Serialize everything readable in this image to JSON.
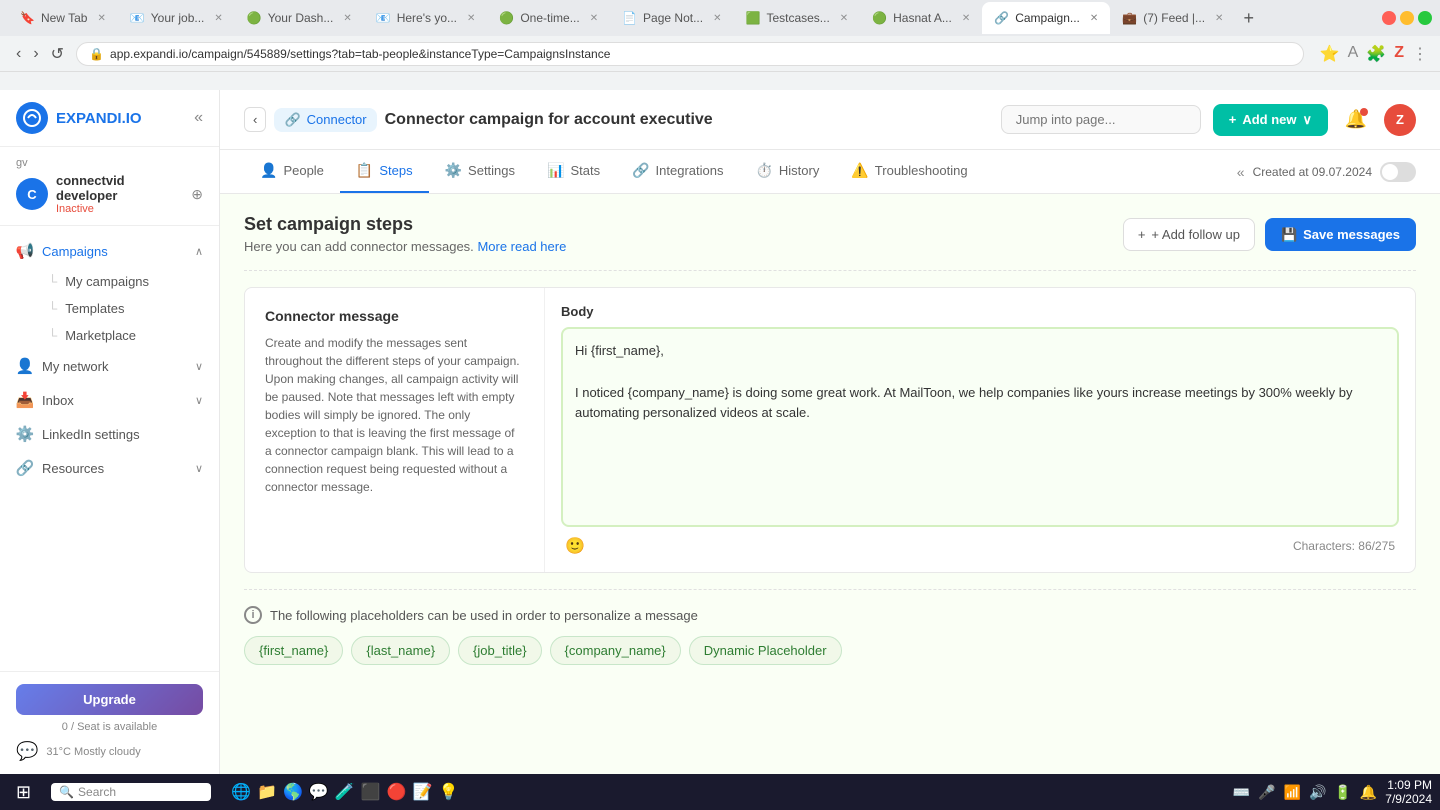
{
  "browser": {
    "tabs": [
      {
        "id": "new-tab",
        "label": "New Tab",
        "active": false,
        "favicon": "🔖"
      },
      {
        "id": "your-job",
        "label": "Your job...",
        "active": false,
        "favicon": "📧"
      },
      {
        "id": "your-dash",
        "label": "Your Dash...",
        "active": false,
        "favicon": "🟢"
      },
      {
        "id": "heres-yo",
        "label": "Here's yo...",
        "active": false,
        "favicon": "📧"
      },
      {
        "id": "one-time",
        "label": "One-time...",
        "active": false,
        "favicon": "🟢"
      },
      {
        "id": "page-not",
        "label": "Page Not...",
        "active": false,
        "favicon": "📄"
      },
      {
        "id": "testcases",
        "label": "Testcases...",
        "active": false,
        "favicon": "🟩"
      },
      {
        "id": "hasnat-a",
        "label": "Hasnat A...",
        "active": false,
        "favicon": "🟢"
      },
      {
        "id": "campaign",
        "label": "Campaign...",
        "active": true,
        "favicon": "🔗"
      },
      {
        "id": "linkedin-feed",
        "label": "(7) Feed |...",
        "active": false,
        "favicon": "💼"
      }
    ],
    "url": "app.expandi.io/campaign/545889/settings?tab=tab-people&instanceType=CampaignsInstance"
  },
  "sidebar": {
    "logo": "EXPANDI.IO",
    "collapse_icon": "«",
    "user": {
      "id": "gv",
      "avatar_letter": "C",
      "name": "connectvid developer",
      "status": "Inactive"
    },
    "nav_items": [
      {
        "id": "campaigns",
        "label": "Campaigns",
        "icon": "📢",
        "expanded": true
      },
      {
        "id": "my-campaigns",
        "label": "My campaigns",
        "active": false
      },
      {
        "id": "templates",
        "label": "Templates",
        "active": false
      },
      {
        "id": "marketplace",
        "label": "Marketplace",
        "active": false
      },
      {
        "id": "my-network",
        "label": "My network",
        "icon": "👤",
        "expanded": false
      },
      {
        "id": "inbox",
        "label": "Inbox",
        "icon": "📥",
        "expanded": false
      },
      {
        "id": "linkedin-settings",
        "label": "LinkedIn settings",
        "icon": "⚙️"
      },
      {
        "id": "resources",
        "label": "Resources",
        "icon": "🔗",
        "expanded": false
      }
    ],
    "upgrade_label": "Upgrade",
    "seat_info": "0 / Seat is available"
  },
  "topbar": {
    "back_button": "‹",
    "breadcrumb_icon": "🔗",
    "breadcrumb_label": "Connector",
    "campaign_title": "Connector campaign for account executive",
    "jump_placeholder": "Jump into page...",
    "add_new_label": "+ Add new",
    "notification_icon": "🔔",
    "user_avatar": "Z"
  },
  "secondary_bar": {
    "tabs": [
      {
        "id": "people",
        "label": "People",
        "icon": "👤",
        "active": false
      },
      {
        "id": "steps",
        "label": "Steps",
        "icon": "📋",
        "active": true
      },
      {
        "id": "settings",
        "label": "Settings",
        "icon": "⚙️",
        "active": false
      },
      {
        "id": "stats",
        "label": "Stats",
        "icon": "📊",
        "active": false
      },
      {
        "id": "integrations",
        "label": "Integrations",
        "icon": "🔗",
        "active": false
      },
      {
        "id": "history",
        "label": "History",
        "icon": "⏱️",
        "active": false
      },
      {
        "id": "troubleshooting",
        "label": "Troubleshooting",
        "icon": "⚠️",
        "active": false
      }
    ],
    "created_at": "Created at 09.07.2024",
    "toggle_on": false
  },
  "content": {
    "header_title": "Set campaign steps",
    "header_subtitle": "Here you can add connector messages.",
    "header_link": "More read here",
    "add_follow_label": "+ Add follow up",
    "save_label": "💾 Save messages",
    "connector_message": {
      "title": "Connector message",
      "description": "Create and modify the messages sent throughout the different steps of your campaign. Upon making changes, all campaign activity will be paused. Note that messages left with empty bodies will simply be ignored. The only exception to that is leaving the first message of a connector campaign blank. This will lead to a connection request being requested without a connector message."
    },
    "body_label": "Body",
    "message_text": "Hi {first_name},\n\nI noticed {company_name} is doing some great work. At MailToon, we help companies like yours increase meetings by 300% weekly by automating personalized videos at scale.",
    "mailtoon_underline": "MailToon",
    "char_count": "Characters: 86/275",
    "emoji_icon": "🙂",
    "placeholders": {
      "info_text": "The following placeholders can be used in order to personalize a message",
      "tags": [
        "{first_name}",
        "{last_name}",
        "{job_title}",
        "{company_name}",
        "Dynamic Placeholder"
      ]
    }
  },
  "taskbar": {
    "start_icon": "⊞",
    "search_placeholder": "Search",
    "icons": [
      "🌐",
      "📁",
      "🌎",
      "💬",
      "🧪",
      "⬛",
      "🔴",
      "📝",
      "💡"
    ],
    "time": "1:09 PM",
    "date": "7/9/2024",
    "weather": "31°C Mostly cloudy"
  }
}
